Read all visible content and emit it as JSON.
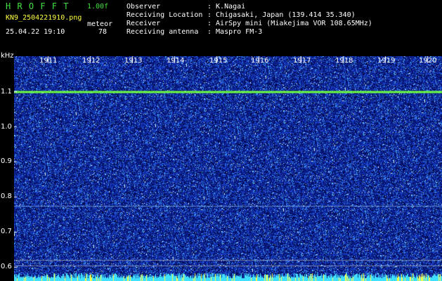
{
  "header": {
    "app_title": "H R O F F T",
    "version": "1.00f",
    "filename": "KN9_2504221910.png",
    "mode": "meteor",
    "datetime": "25.04.22 19:10",
    "count": "78",
    "fields": [
      {
        "label": "Observer",
        "value": ": K.Nagai"
      },
      {
        "label": "Receiving Location",
        "value": ": Chigasaki, Japan (139.414 35.340)"
      },
      {
        "label": "Receiver",
        "value": ": AirSpy mini (Miakejima VOR 108.65MHz)"
      },
      {
        "label": "Receiving antenna",
        "value": ": Maspro FM-3"
      }
    ]
  },
  "axis": {
    "unit": "kHz",
    "y_ticks": [
      "1.1",
      "1.0",
      "0.9",
      "0.8",
      "0.7",
      "0.6"
    ],
    "x_ticks": [
      "1911",
      "1912",
      "1913",
      "1914",
      "1915",
      "1916",
      "1917",
      "1918",
      "1919",
      "1920"
    ]
  },
  "colors": {
    "background": "#000000",
    "noise_dark": "#0a1a8c",
    "noise_mid": "#2f5fe0",
    "carrier_line": "#6fff3f",
    "baseline_bar": "#3fe0ff"
  }
}
